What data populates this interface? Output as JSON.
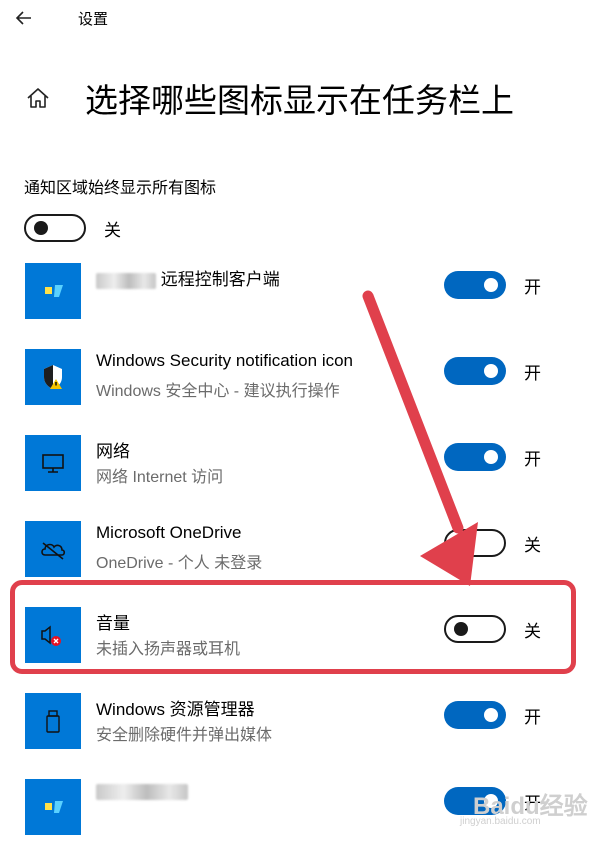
{
  "header": {
    "app_title": "设置"
  },
  "page": {
    "title": "选择哪些图标显示在任务栏上"
  },
  "master": {
    "label": "通知区域始终显示所有图标",
    "state_label": "关",
    "on": false
  },
  "apps": [
    {
      "name_suffix": "远程控制客户端",
      "sub": "",
      "state_label": "开",
      "on": true,
      "icon": "remote-control-icon"
    },
    {
      "name": "Windows Security notification icon",
      "sub": "Windows 安全中心 - 建议执行操作",
      "state_label": "开",
      "on": true,
      "icon": "shield-warning-icon"
    },
    {
      "name": "网络",
      "sub": "网络 Internet 访问",
      "state_label": "开",
      "on": true,
      "icon": "network-monitor-icon"
    },
    {
      "name": "Microsoft OneDrive",
      "sub": "OneDrive - 个人 未登录",
      "state_label": "关",
      "on": false,
      "icon": "onedrive-cloud-icon"
    },
    {
      "name": "音量",
      "sub": "未插入扬声器或耳机",
      "state_label": "关",
      "on": false,
      "icon": "speaker-muted-icon"
    },
    {
      "name": "Windows 资源管理器",
      "sub": "安全删除硬件并弹出媒体",
      "state_label": "开",
      "on": true,
      "icon": "usb-drive-icon"
    },
    {
      "name": "",
      "sub": "",
      "state_label": "开",
      "on": true,
      "icon": "app-icon"
    }
  ],
  "watermark": {
    "text": "Baidu经验",
    "sub": "jingyan.baidu.com"
  },
  "colors": {
    "accent": "#0067c0",
    "tile": "#0078d7",
    "annotation": "#e0404c"
  }
}
